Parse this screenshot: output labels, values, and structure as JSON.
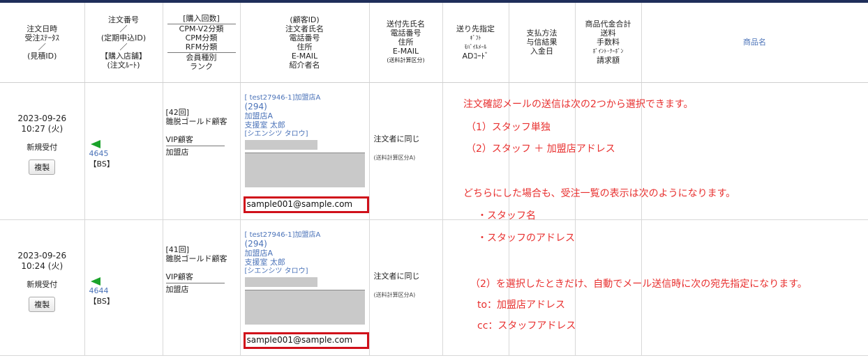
{
  "headers": {
    "col1": [
      "注文日時",
      "受注ｽﾃｰﾀｽ",
      "／",
      "(見積ID)"
    ],
    "col2": [
      "注文番号",
      "／",
      "(定期申込ID)",
      "／",
      "【購入店舗】",
      "(注文ﾙｰﾄ)"
    ],
    "col3": [
      "[購入回数]",
      "CPM-V2分類",
      "CPM分類",
      "RFM分類",
      "会員種別",
      "ランク"
    ],
    "col4": [
      "(顧客ID)",
      "注文者氏名",
      "電話番号",
      "住所",
      "E-MAIL",
      "紹介者名"
    ],
    "col5": [
      "送付先氏名",
      "電話番号",
      "住所",
      "E-MAIL",
      "(送料計算区分)"
    ],
    "col6": [
      "送り先指定",
      "ｷﾞﾌﾄ",
      "ﾓﾊﾞｲﾙﾒｰﾙ",
      "ADｺｰﾄﾞ"
    ],
    "col7": [
      "支払方法",
      "与信結果",
      "入金日"
    ],
    "col8": [
      "商品代金合計",
      "送料",
      "手数料",
      "ﾎﾟｲﾝﾄ･ｸｰﾎﾟﾝ",
      "請求額"
    ],
    "col9": "商品名"
  },
  "rows": [
    {
      "date": "2023-09-26",
      "time": "10:27 (火)",
      "status": "新規受付",
      "copy_label": "複製",
      "order_no": "4645",
      "route": "【BS】",
      "purchase_count": "[42回]",
      "rank_class": "雛脱ゴールド顧客",
      "member_type": "VIP顧客",
      "rank": "加盟店",
      "customer_id": "[ test27946-1]加盟店A",
      "phone": "(294)",
      "store": "加盟店A",
      "name": "支援室 太郎",
      "kana": "[シエンシツ タロウ]",
      "email": "sample001@sample.com",
      "ship_to": "注文者に同じ",
      "ship_note": "(送料計算区分A)"
    },
    {
      "date": "2023-09-26",
      "time": "10:24 (火)",
      "status": "新規受付",
      "copy_label": "複製",
      "order_no": "4644",
      "route": "【BS】",
      "purchase_count": "[41回]",
      "rank_class": "雛脱ゴールド顧客",
      "member_type": "VIP顧客",
      "rank": "加盟店",
      "customer_id": "[ test27946-1]加盟店A",
      "phone": "(294)",
      "store": "加盟店A",
      "name": "支援室 太郎",
      "kana": "[シエンシツ タロウ]",
      "email": "sample001@sample.com",
      "ship_to": "注文者に同じ",
      "ship_note": "(送料計算区分A)"
    }
  ],
  "annotation": {
    "line1": "注文確認メールの送信は次の2つから選択できます。",
    "line2": "（1）スタッフ単独",
    "line3": "（2）スタッフ ＋ 加盟店アドレス",
    "line4": "どちらにした場合も、受注一覧の表示は次のようになります。",
    "line5": "・スタッフ名",
    "line6": "・スタッフのアドレス",
    "line7": "（2）を選択したときだけ、自動でメール送信時に次の宛先指定になります。",
    "line8": "to：加盟店アドレス",
    "line9": "cc：スタッフアドレス"
  },
  "colors": {
    "accent_red": "#d0101a",
    "link_blue": "#4a72b8",
    "flag_green": "#1aa32a",
    "topbar": "#1f2e5a"
  }
}
